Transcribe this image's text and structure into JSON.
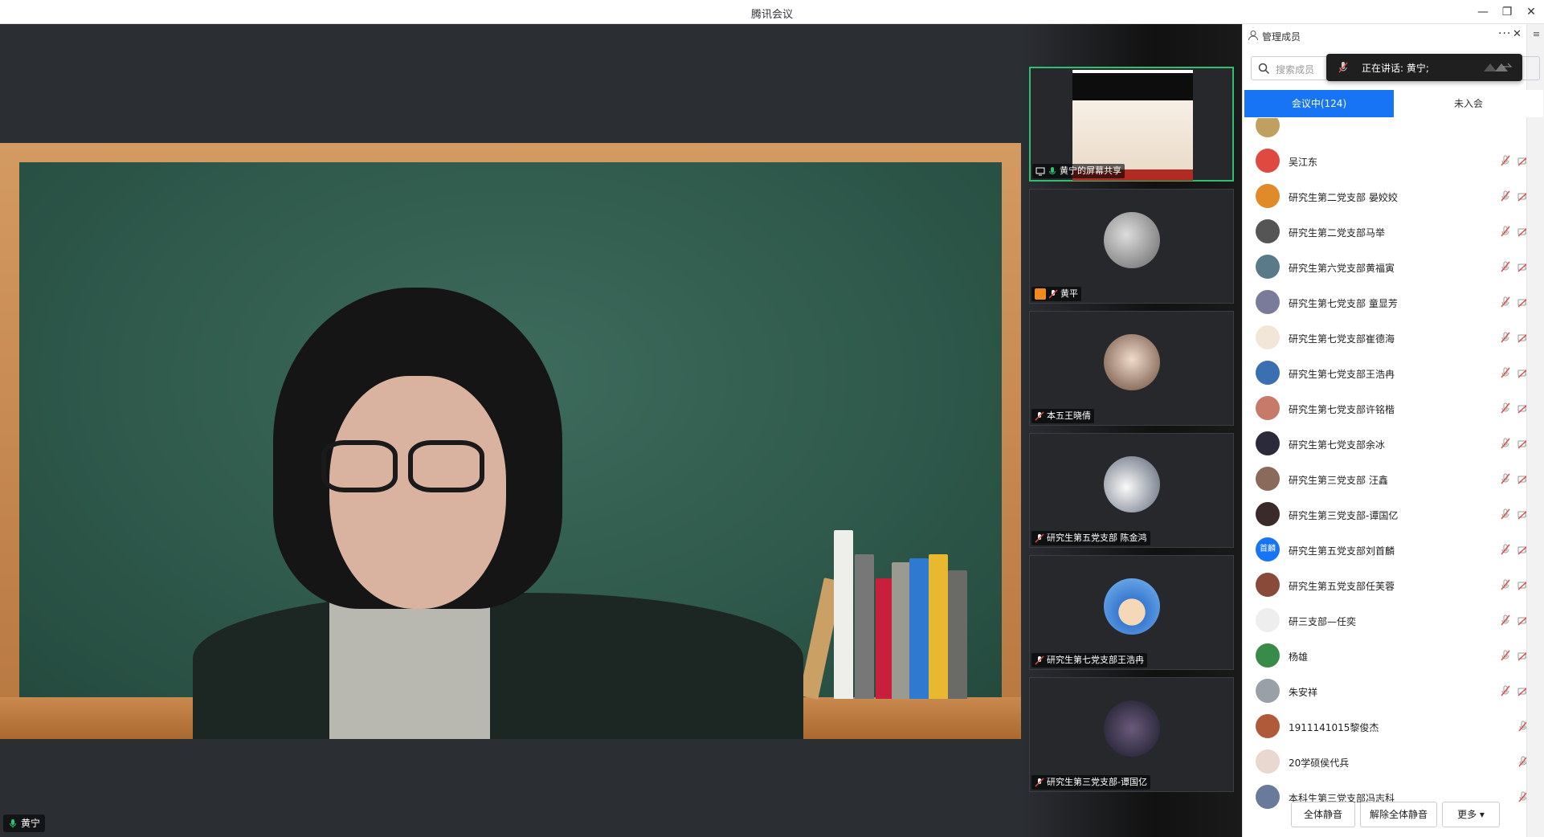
{
  "window": {
    "title": "腾讯会议",
    "min_icon": "minimize-icon",
    "restore_icon": "restore-icon",
    "close_icon": "close-icon"
  },
  "speaker": {
    "name": "黄宁"
  },
  "thumbnails": [
    {
      "label": "黄宁的屏幕共享",
      "type": "screen-share"
    },
    {
      "label": "黄平",
      "type": "avatar"
    },
    {
      "label": "本五王晓倩",
      "type": "avatar"
    },
    {
      "label": "研究生第五党支部 陈金鸿",
      "type": "avatar"
    },
    {
      "label": "研究生第七党支部王浩冉",
      "type": "avatar"
    },
    {
      "label": "研究生第三党支部-谭国亿",
      "type": "avatar"
    }
  ],
  "panel": {
    "title": "管理成员",
    "more": "···",
    "close": "✕",
    "menu": "≡",
    "search_placeholder": "搜索成员",
    "speaking_text": "正在讲话: 黄宁;",
    "tabs": [
      {
        "label": "会议中(124)"
      },
      {
        "label": "未入会"
      }
    ],
    "members": [
      {
        "name": "吴江东",
        "avatar_text": "",
        "color": "#e0493f"
      },
      {
        "name": "研究生第二党支部 晏姣姣",
        "avatar_text": "",
        "color": "#e08a2a"
      },
      {
        "name": "研究生第二党支部马举",
        "avatar_text": "",
        "color": "#555555"
      },
      {
        "name": "研究生第六党支部黄福寅",
        "avatar_text": "",
        "color": "#5a7a8a"
      },
      {
        "name": "研究生第七党支部 童显芳",
        "avatar_text": "",
        "color": "#7a7a9a"
      },
      {
        "name": "研究生第七党支部崔德海",
        "avatar_text": "",
        "color": "#f2e6d8"
      },
      {
        "name": "研究生第七党支部王浩冉",
        "avatar_text": "",
        "color": "#3a6fb0"
      },
      {
        "name": "研究生第七党支部许铭楷",
        "avatar_text": "",
        "color": "#c87a6a"
      },
      {
        "name": "研究生第七党支部余冰",
        "avatar_text": "",
        "color": "#2a2a3a"
      },
      {
        "name": "研究生第三党支部 汪鑫",
        "avatar_text": "",
        "color": "#8a6a5a"
      },
      {
        "name": "研究生第三党支部-谭国亿",
        "avatar_text": "",
        "color": "#3a2a2a"
      },
      {
        "name": "研究生第五党支部刘首麟",
        "avatar_text": "首麟",
        "color": "#1674f5"
      },
      {
        "name": "研究生第五党支部任芙蓉",
        "avatar_text": "",
        "color": "#8a4a3a"
      },
      {
        "name": "研三支部—任奕",
        "avatar_text": "",
        "color": "#eeeeee"
      },
      {
        "name": "杨雄",
        "avatar_text": "",
        "color": "#3a8a4a"
      },
      {
        "name": "朱安祥",
        "avatar_text": "",
        "color": "#9aa0a8"
      },
      {
        "name": "1911141015黎俊杰",
        "avatar_text": "",
        "color": "#b05a3a"
      },
      {
        "name": "20学硕侯代兵",
        "avatar_text": "",
        "color": "#e8d8d0"
      },
      {
        "name": "本科生第三党支部冯志科",
        "avatar_text": "",
        "color": "#6a7a9a"
      }
    ],
    "footer": {
      "mute_all": "全体静音",
      "unmute_all": "解除全体静音",
      "more": "更多 ▾"
    }
  },
  "colors": {
    "accent": "#1674f5",
    "muted_red": "#e04848",
    "stage_bg": "#2b2e33"
  }
}
